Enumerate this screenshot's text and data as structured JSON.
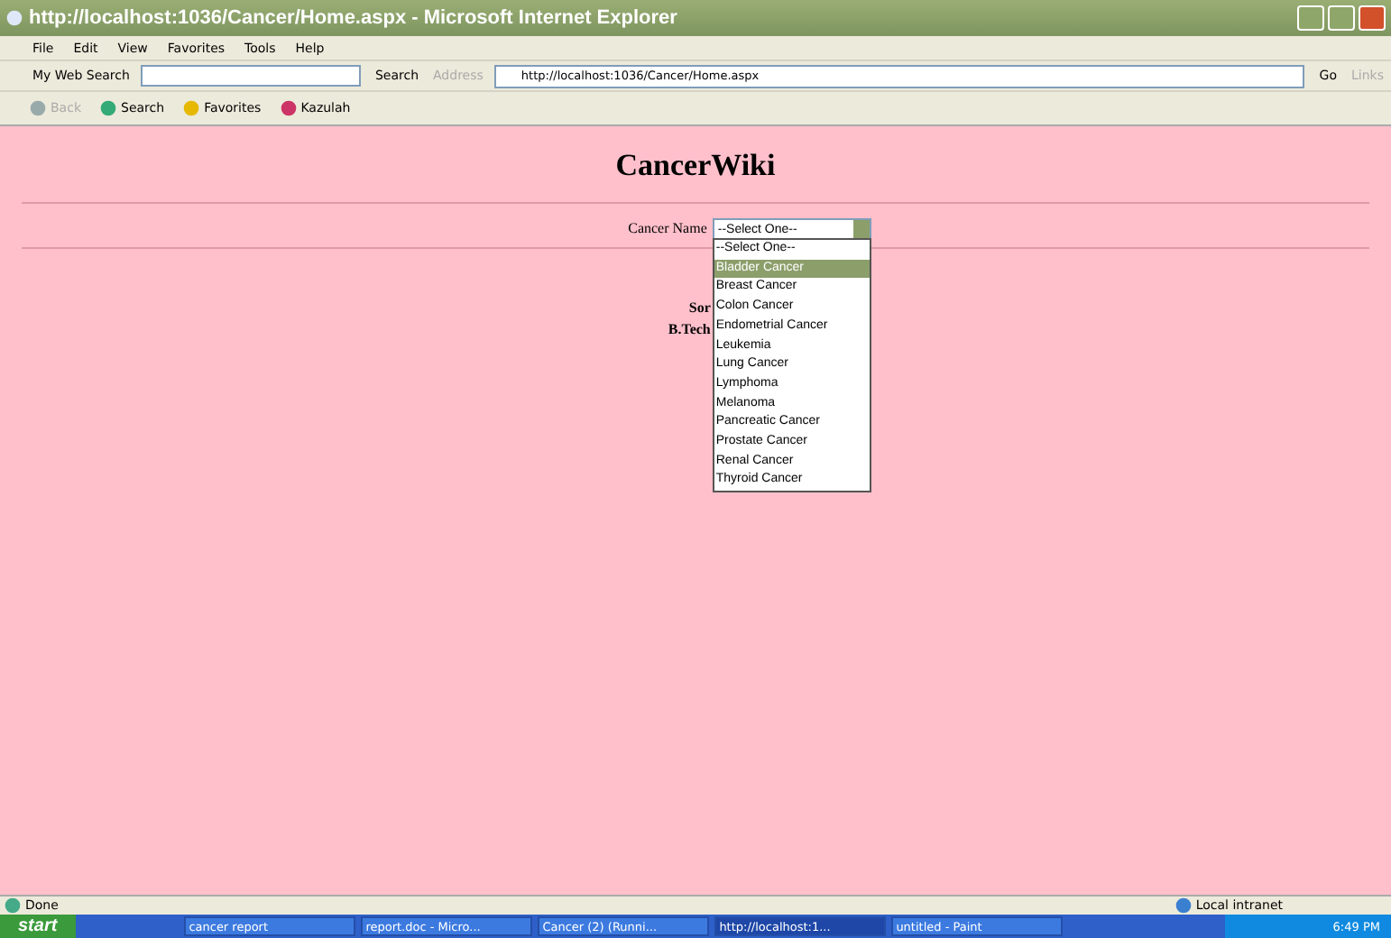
{
  "window": {
    "title": "http://localhost:1036/Cancer/Home.aspx - Microsoft Internet Explorer"
  },
  "menu": [
    "File",
    "Edit",
    "View",
    "Favorites",
    "Tools",
    "Help"
  ],
  "search_bar": {
    "label": "My Web Search",
    "button": "Search",
    "address_label": "Address",
    "address": "http://localhost:1036/Cancer/Home.aspx",
    "go": "Go",
    "links": "Links"
  },
  "toolbar": [
    "Back",
    "Search",
    "Favorites",
    "Kazulah"
  ],
  "page": {
    "heading": "CancerWiki",
    "field_label": "Cancer Name",
    "select_value": "--Select One--",
    "options": [
      {
        "label": "--Select One--",
        "selected": false
      },
      {
        "label": "Bladder Cancer",
        "selected": true
      },
      {
        "label": "Breast Cancer",
        "selected": false
      },
      {
        "label": "Colon Cancer",
        "selected": false
      },
      {
        "label": "Endometrial Cancer",
        "selected": false
      },
      {
        "label": "Leukemia",
        "selected": false
      },
      {
        "label": "Lung Cancer",
        "selected": false
      },
      {
        "label": "Lymphoma",
        "selected": false
      },
      {
        "label": "Melanoma",
        "selected": false
      },
      {
        "label": "Pancreatic Cancer",
        "selected": false
      },
      {
        "label": "Prostate Cancer",
        "selected": false
      },
      {
        "label": "Renal Cancer",
        "selected": false
      },
      {
        "label": "Thyroid Cancer",
        "selected": false
      }
    ],
    "hidden_text": [
      "Sor",
      "B.Tech"
    ]
  },
  "status_bar": {
    "text": "Done",
    "zone": "Local intranet"
  },
  "taskbar": {
    "start": "start",
    "items": [
      {
        "label": "cancer report",
        "selected": false
      },
      {
        "label": "report.doc - Micro...",
        "selected": false
      },
      {
        "label": "Cancer (2) (Runni...",
        "selected": false
      },
      {
        "label": "http://localhost:1...",
        "selected": true
      },
      {
        "label": "untitled - Paint",
        "selected": false
      }
    ],
    "clock": "6:49 PM"
  }
}
